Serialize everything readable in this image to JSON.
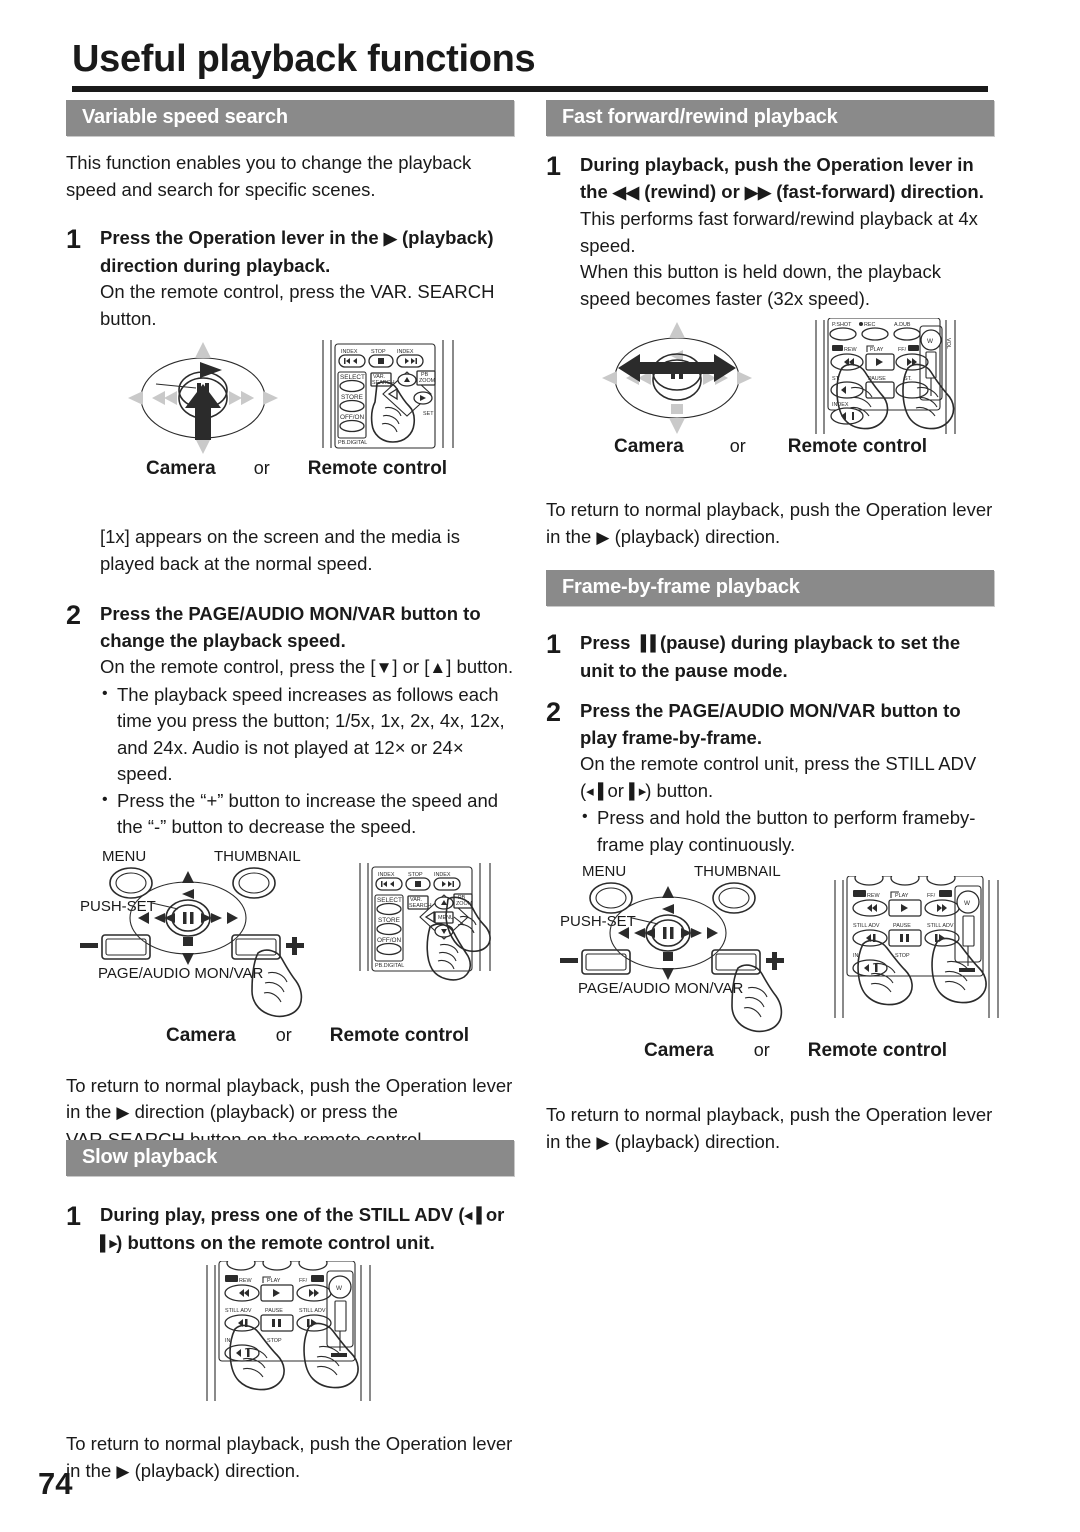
{
  "document": {
    "title": "Useful playback functions",
    "page_number": "74"
  },
  "left_column": {
    "sections": [
      {
        "heading": "Variable speed search",
        "intro": "This function enables you to change the playback speed and search for specific scenes.",
        "step1": {
          "number": "1",
          "bold_a": "Press the Operation lever in the",
          "glyph_a": "▶",
          "bold_b": "(playback) direction during playback.",
          "sub": "On the remote control, press the VAR. SEARCH button.",
          "figure": {
            "camera_label": "Camera",
            "or_label": "or",
            "remote_label": "Remote control",
            "remote_buttons": {
              "index_left": "INDEX",
              "stop": "STOP",
              "index_right": "INDEX",
              "select": "SELECT",
              "store": "STORE",
              "offon": "OFF/ON",
              "photo_digital": "PB.DIGITAL",
              "var_search": "VAR. SEARCH",
              "pb_zoom": "PB ZOOM",
              "set": "SET"
            }
          }
        },
        "after_step1": "[1x] appears on the screen and the media is played back at the normal speed.",
        "step2": {
          "number": "2",
          "bold": "Press the PAGE/AUDIO MON/VAR button to change the playback speed.",
          "sub_a": "On the remote control, press the [",
          "sub_glyph_down": "▼",
          "sub_b": "] or [",
          "sub_glyph_up": "▲",
          "sub_c": "] button.",
          "bullets": [
            "The playback speed increases as follows each time you press the button; 1/5x, 1x, 2x, 4x, 12x, and 24x. Audio is not played at 12× or 24× speed.",
            "Press the “+” button to increase the speed and the “-” button to decrease the speed."
          ],
          "figure": {
            "menu_label": "MENU",
            "thumbnail_label": "THUMBNAIL",
            "push_set_label": "PUSH-SET",
            "page_audio_label": "PAGE/AUDIO MON/VAR",
            "minus": "–",
            "plus": "+",
            "camera_label": "Camera",
            "or_label": "or",
            "remote_label": "Remote control",
            "remote_buttons": {
              "index_left": "INDEX",
              "stop": "STOP",
              "index_right": "INDEX",
              "select": "SELECT",
              "store": "STORE",
              "offon": "OFF/ON",
              "photo_digital": "PB.DIGITAL",
              "var_search": "VAR. SEARCH",
              "pb_zoom": "PB ZOOM",
              "menu": "MENU"
            }
          }
        },
        "closing": "To return to normal playback, push the Operation lever in the ▶ direction (playback) or press the VAR.SEARCH button on the remote control.",
        "closing_parts": {
          "a": "To return to normal playback, push the Operation lever in the",
          "glyph": "▶",
          "b": "direction (playback) or press the VAR.SEARCH button on the remote control."
        }
      },
      {
        "heading": "Slow playback",
        "step1": {
          "number": "1",
          "bold_a": "During play, press one of the STILL ADV (",
          "glyph_a": "◂▐",
          "bold_b": "or",
          "glyph_b": "▌▸",
          "bold_c": ") buttons on the remote control unit.",
          "figure": {
            "remote_buttons": {
              "rew": "REW",
              "play": "PLAY",
              "ff": "FF",
              "still_adv_left": "STILL ADV",
              "pause": "PAUSE",
              "still_adv_right": "STILL ADV",
              "stop": "STOP",
              "index": "INDEX",
              "w": "W"
            }
          }
        },
        "closing_parts": {
          "a": "To return to normal playback, push the Operation lever in the",
          "glyph": "▶",
          "b": "(playback) direction."
        }
      }
    ]
  },
  "right_column": {
    "sections": [
      {
        "heading": "Fast forward/rewind playback",
        "step1": {
          "number": "1",
          "bold_a": "During playback, push the Operation lever in the",
          "glyph_rew": "◀◀",
          "bold_b": "(rewind) or",
          "glyph_ff": "▶▶",
          "bold_c": "(fast-forward) direction.",
          "sub_a": "This performs fast forward/rewind playback at 4x speed.",
          "sub_b": "When this button is held down, the playback speed becomes faster (32x speed).",
          "figure": {
            "camera_label": "Camera",
            "or_label": "or",
            "remote_label": "Remote control",
            "remote_buttons": {
              "photoshot": "P.SHOT",
              "rec": "REC",
              "adub": "A.DUB",
              "rew": "REW",
              "play": "PLAY",
              "ff": "FF",
              "pause": "PAUSE",
              "still": "ST.",
              "index": "INDEX",
              "w": "W",
              "vol": "VOL"
            }
          }
        },
        "closing_parts": {
          "a": "To return to normal playback, push the Operation lever in the",
          "glyph": "▶",
          "b": "(playback) direction."
        }
      },
      {
        "heading": "Frame-by-frame playback",
        "step1": {
          "number": "1",
          "bold_a": "Press",
          "glyph_pause": "▐▐",
          "bold_b": "(pause) during playback to set the unit to the pause mode."
        },
        "step2": {
          "number": "2",
          "bold": "Press the PAGE/AUDIO MON/VAR button to play frame-by-frame.",
          "sub_a": "On the remote control unit, press the STILL ADV (",
          "sub_glyph_a": "◂▐",
          "sub_b": "or",
          "sub_glyph_b": "▌▸",
          "sub_c": ") button.",
          "bullets": [
            "Press and hold the button to perform frameby-frame play continuously."
          ],
          "figure": {
            "menu_label": "MENU",
            "thumbnail_label": "THUMBNAIL",
            "push_set_label": "PUSH-SET",
            "page_audio_label": "PAGE/AUDIO MON/VAR",
            "minus": "–",
            "plus": "+",
            "camera_label": "Camera",
            "or_label": "or",
            "remote_label": "Remote control",
            "remote_buttons": {
              "rew": "REW",
              "play": "PLAY",
              "ff": "FF",
              "still_adv_left": "STILL ADV",
              "pause": "PAUSE",
              "still_adv_right": "STILL ADV",
              "stop": "STOP",
              "index": "IN",
              "w": "W"
            }
          }
        },
        "closing_parts": {
          "a": "To return to normal playback, push the Operation lever in the",
          "glyph": "▶",
          "b": "(playback) direction."
        }
      }
    ]
  },
  "colors": {
    "section_bar": "#8a8a8a",
    "text": "#1a1a1a",
    "rule": "#1a1a1a"
  }
}
